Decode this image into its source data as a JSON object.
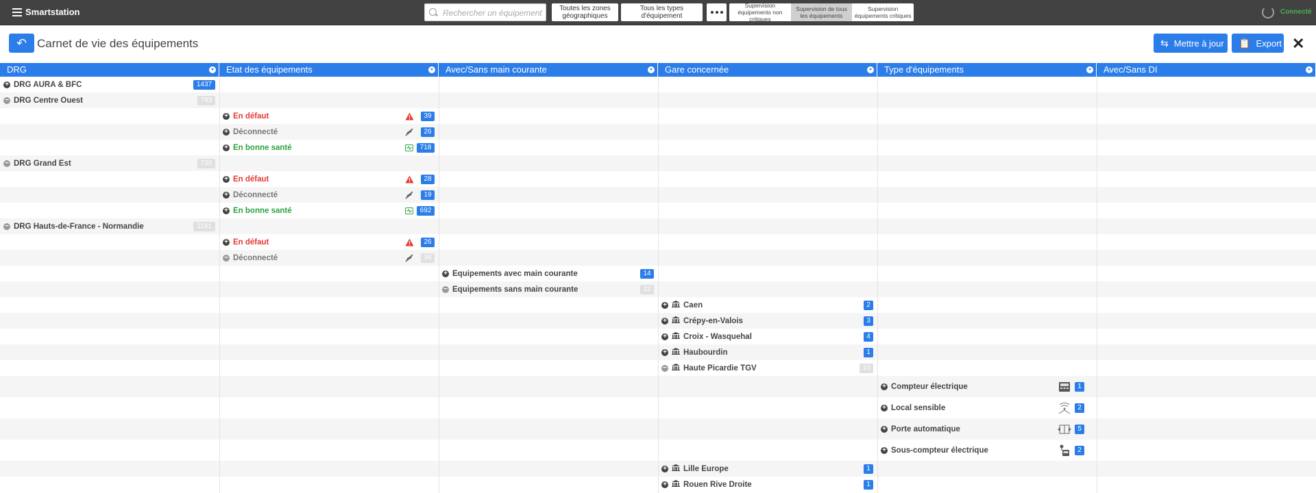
{
  "app": {
    "name": "Smartstation",
    "status": "Connecté"
  },
  "toolbar": {
    "search_placeholder": "Rechercher un équipement",
    "zones_label": "Toutes les zones géographiques",
    "types_label": "Tous les types d'équipement",
    "segments": [
      {
        "label": "Supervision équipements non critiques",
        "selected": false
      },
      {
        "label": "Supervision de tous les équipements",
        "selected": true
      },
      {
        "label": "Supervision équipements critiques",
        "selected": false
      }
    ]
  },
  "page": {
    "title": "Carnet de vie des équipements",
    "update_label": "Mettre à jour",
    "export_label": "Export"
  },
  "columns": [
    "DRG",
    "Etat des équipements",
    "Avec/Sans main courante",
    "Gare concernée",
    "Type d'équipements",
    "Avec/Sans DI"
  ],
  "rows": [
    {
      "col": 0,
      "toggle": "plus",
      "label": "DRG AURA & BFC",
      "style": "dark",
      "badge": "1437",
      "badge_style": "blue"
    },
    {
      "col": 0,
      "toggle": "minus",
      "label": "DRG Centre Ouest",
      "style": "dark",
      "badge": "783",
      "badge_style": "grey"
    },
    {
      "col": 1,
      "toggle": "plus",
      "label": "En défaut",
      "style": "red",
      "icon": "warning-icon",
      "badge": "39",
      "badge_style": "blue"
    },
    {
      "col": 1,
      "toggle": "plus",
      "label": "Déconnecté",
      "style": "dim",
      "icon": "unplug-icon",
      "badge": "26",
      "badge_style": "blue"
    },
    {
      "col": 1,
      "toggle": "plus",
      "label": "En bonne santé",
      "style": "green",
      "icon": "health-icon",
      "badge": "718",
      "badge_style": "blue"
    },
    {
      "col": 0,
      "toggle": "minus",
      "label": "DRG Grand Est",
      "style": "dark",
      "badge": "739",
      "badge_style": "grey"
    },
    {
      "col": 1,
      "toggle": "plus",
      "label": "En défaut",
      "style": "red",
      "icon": "warning-icon",
      "badge": "28",
      "badge_style": "blue"
    },
    {
      "col": 1,
      "toggle": "plus",
      "label": "Déconnecté",
      "style": "dim",
      "icon": "unplug-icon",
      "badge": "19",
      "badge_style": "blue"
    },
    {
      "col": 1,
      "toggle": "plus",
      "label": "En bonne santé",
      "style": "green",
      "icon": "health-icon",
      "badge": "692",
      "badge_style": "blue"
    },
    {
      "col": 0,
      "toggle": "minus",
      "label": "DRG Hauts-de-France - Normandie",
      "style": "dark",
      "badge": "1191",
      "badge_style": "grey"
    },
    {
      "col": 1,
      "toggle": "plus",
      "label": "En défaut",
      "style": "red",
      "icon": "warning-icon",
      "badge": "26",
      "badge_style": "blue"
    },
    {
      "col": 1,
      "toggle": "minus",
      "label": "Déconnecté",
      "style": "dim",
      "icon": "unplug-icon",
      "badge": "36",
      "badge_style": "grey"
    },
    {
      "col": 2,
      "toggle": "plus",
      "label": "Equipements avec main courante",
      "style": "dark",
      "badge": "14",
      "badge_style": "blue"
    },
    {
      "col": 2,
      "toggle": "minus",
      "label": "Equipements sans main courante",
      "style": "dark",
      "badge": "22",
      "badge_style": "grey"
    },
    {
      "col": 3,
      "toggle": "plus",
      "label": "Caen",
      "style": "dark",
      "icon": "station-icon",
      "badge": "2",
      "badge_style": "blue"
    },
    {
      "col": 3,
      "toggle": "plus",
      "label": "Crépy-en-Valois",
      "style": "dark",
      "icon": "station-icon",
      "badge": "3",
      "badge_style": "blue"
    },
    {
      "col": 3,
      "toggle": "plus",
      "label": "Croix - Wasquehal",
      "style": "dark",
      "icon": "station-icon",
      "badge": "4",
      "badge_style": "blue"
    },
    {
      "col": 3,
      "toggle": "plus",
      "label": "Haubourdin",
      "style": "dark",
      "icon": "station-icon",
      "badge": "1",
      "badge_style": "blue"
    },
    {
      "col": 3,
      "toggle": "minus",
      "label": "Haute Picardie TGV",
      "style": "dark",
      "icon": "station-icon",
      "badge": "10",
      "badge_style": "grey"
    },
    {
      "col": 4,
      "toggle": "plus",
      "label": "Compteur électrique",
      "style": "dark",
      "icon": "meter-icon",
      "badge": "1",
      "badge_style": "blue"
    },
    {
      "col": 4,
      "toggle": "plus",
      "label": "Local sensible",
      "style": "dark",
      "icon": "sensitive-room-icon",
      "badge": "2",
      "badge_style": "blue"
    },
    {
      "col": 4,
      "toggle": "plus",
      "label": "Porte automatique",
      "style": "dark",
      "icon": "automatic-door-icon",
      "badge": "5",
      "badge_style": "blue"
    },
    {
      "col": 4,
      "toggle": "plus",
      "label": "Sous-compteur électrique",
      "style": "dark",
      "icon": "sub-meter-icon",
      "badge": "2",
      "badge_style": "blue"
    },
    {
      "col": 3,
      "toggle": "plus",
      "label": "Lille Europe",
      "style": "dark",
      "icon": "station-icon",
      "badge": "1",
      "badge_style": "blue"
    },
    {
      "col": 3,
      "toggle": "plus",
      "label": "Rouen Rive Droite",
      "style": "dark",
      "icon": "station-icon",
      "badge": "1",
      "badge_style": "blue"
    }
  ],
  "colors": {
    "accent": "#2b7de9",
    "topbar": "#424242",
    "danger": "#e53935",
    "ok": "#2ca340",
    "connected": "#4caf50"
  }
}
